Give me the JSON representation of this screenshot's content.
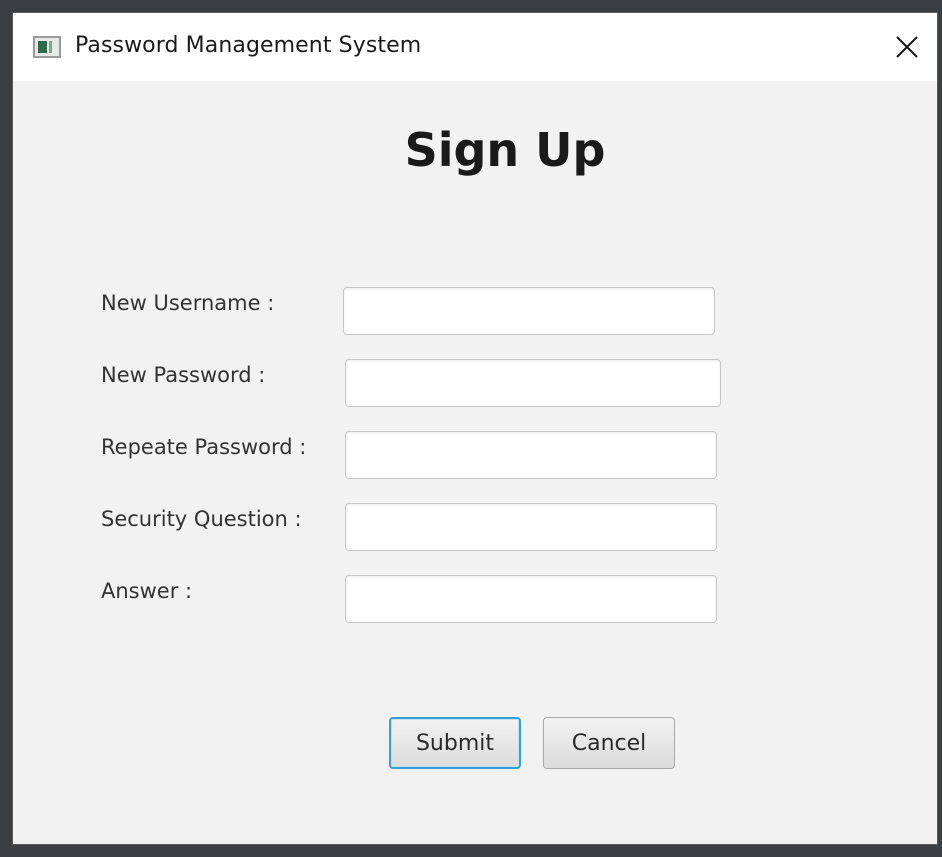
{
  "window": {
    "title": "Password Management System"
  },
  "heading": "Sign Up",
  "form": {
    "fields": [
      {
        "label": "New Username :",
        "value": ""
      },
      {
        "label": "New Password :",
        "value": ""
      },
      {
        "label": "Repeate Password :",
        "value": ""
      },
      {
        "label": "Security Question :",
        "value": ""
      },
      {
        "label": "Answer :",
        "value": ""
      }
    ]
  },
  "buttons": {
    "submit": "Submit",
    "cancel": "Cancel"
  },
  "colors": {
    "focus_accent": "#3a9fd8",
    "window_bg": "#f2f2f2"
  }
}
